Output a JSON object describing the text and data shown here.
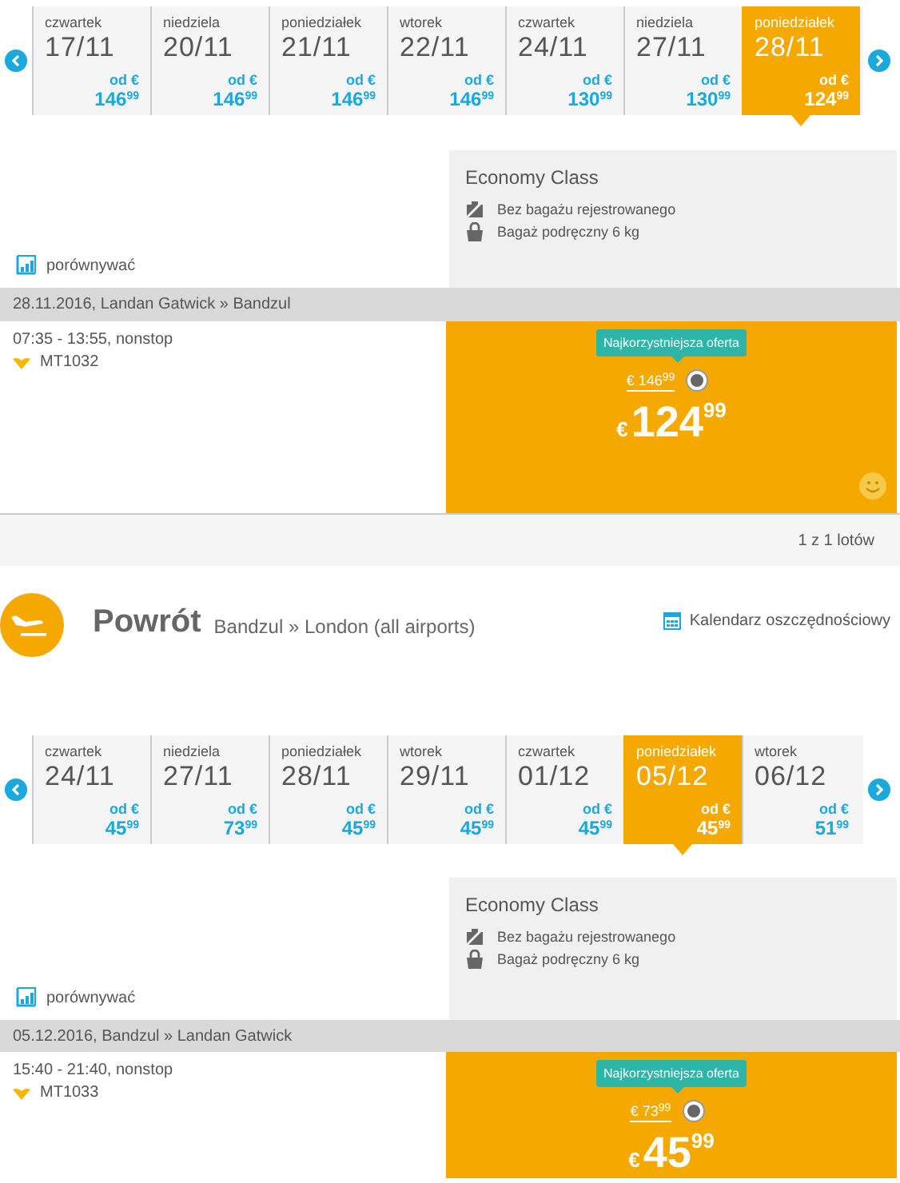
{
  "outbound": {
    "dates": [
      {
        "weekday": "czwartek",
        "date": "17/11",
        "from_label": "od €",
        "price": "146$^{99}$",
        "selected": false
      },
      {
        "weekday": "niedziela",
        "date": "20/11",
        "from_label": "od €",
        "price": "146$^{99}$",
        "selected": false
      },
      {
        "weekday": "poniedziałek",
        "date": "21/11",
        "from_label": "od €",
        "price": "146$^{99}$",
        "selected": false
      },
      {
        "weekday": "wtorek",
        "date": "22/11",
        "from_label": "od €",
        "price": "146$^{99}$",
        "selected": false
      },
      {
        "weekday": "czwartek",
        "date": "24/11",
        "from_label": "od €",
        "price": "130$^{99}$",
        "selected": false
      },
      {
        "weekday": "niedziela",
        "date": "27/11",
        "from_label": "od €",
        "price": "130$^{99}$",
        "selected": false
      },
      {
        "weekday": "poniedziałek",
        "date": "28/11",
        "from_label": "od €",
        "price": "124$^{99}$",
        "selected": true
      }
    ],
    "compare": "porównywać",
    "fare": {
      "class": "Economy Class",
      "features": [
        {
          "kind": "no-checked-bag",
          "text": "Bez bagażu rejestrowanego"
        },
        {
          "kind": "cabin-bag",
          "text": "Bagaż podręczny 6 kg"
        }
      ]
    },
    "route_bar": "28.11.2016, Landan Gatwick » Bandzul",
    "flight": {
      "times": "07:35 - 13:55, nonstop",
      "number": "MT1032"
    },
    "offer": {
      "badge": "Najkorzystniejsza oferta",
      "old_price": "€ 146$^{99}$",
      "currency": "€",
      "price": "124$^{99}$",
      "selected": true
    },
    "pagination": "1 z 1 lotów"
  },
  "return_header": {
    "title": "Powrót",
    "route": "Bandzul » London (all airports)",
    "calendar_link": "Kalendarz oszczędnościowy"
  },
  "return": {
    "dates": [
      {
        "weekday": "czwartek",
        "date": "24/11",
        "from_label": "od €",
        "price": "45$^{99}$",
        "selected": false
      },
      {
        "weekday": "niedziela",
        "date": "27/11",
        "from_label": "od €",
        "price": "73$^{99}$",
        "selected": false
      },
      {
        "weekday": "poniedziałek",
        "date": "28/11",
        "from_label": "od €",
        "price": "45$^{99}$",
        "selected": false
      },
      {
        "weekday": "wtorek",
        "date": "29/11",
        "from_label": "od €",
        "price": "45$^{99}$",
        "selected": false
      },
      {
        "weekday": "czwartek",
        "date": "01/12",
        "from_label": "od €",
        "price": "45$^{99}$",
        "selected": false
      },
      {
        "weekday": "poniedziałek",
        "date": "05/12",
        "from_label": "od €",
        "price": "45$^{99}$",
        "selected": true
      },
      {
        "weekday": "wtorek",
        "date": "06/12",
        "from_label": "od €",
        "price": "51$^{99}$",
        "selected": false
      }
    ],
    "compare": "porównywać",
    "fare": {
      "class": "Economy Class",
      "features": [
        {
          "kind": "no-checked-bag",
          "text": "Bez bagażu rejestrowanego"
        },
        {
          "kind": "cabin-bag",
          "text": "Bagaż podręczny 6 kg"
        }
      ]
    },
    "route_bar": "05.12.2016, Bandzul » Landan Gatwick",
    "flight": {
      "times": "15:40 - 21:40, nonstop",
      "number": "MT1033"
    },
    "offer": {
      "badge": "Najkorzystniejsza oferta",
      "old_price": "€ 73$^{99}$",
      "currency": "€",
      "price": "45$^{99}$",
      "selected": true
    }
  }
}
